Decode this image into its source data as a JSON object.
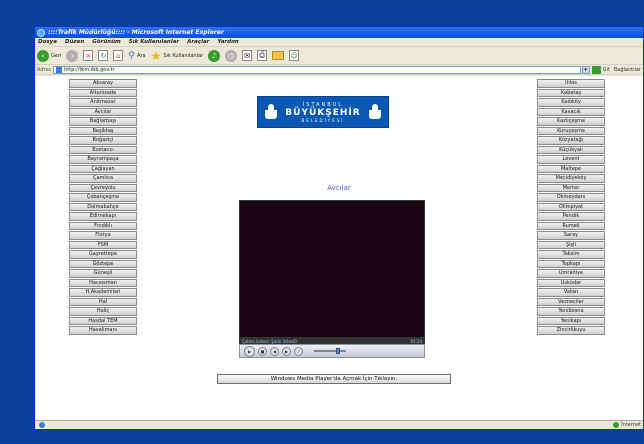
{
  "window": {
    "title": "::::Trafik Müdürlüğü:::: - Microsoft Internet Explorer"
  },
  "menu": [
    "Dosya",
    "Düzen",
    "Görünüm",
    "Sık Kullanılanlar",
    "Araçlar",
    "Yardım"
  ],
  "toolbar": {
    "back_label": "Geri",
    "search_label": "Ara",
    "favorites_label": "Sık Kullanılanlar"
  },
  "addressbar": {
    "label": "Adres",
    "url": "http://tkm.ibb.gov.tr",
    "go_label": "Git",
    "links_label": "Bağlantılar"
  },
  "logo": {
    "line1": "İSTANBUL",
    "line2": "BÜYÜKŞEHİR",
    "line3": "BELEDİYESİ"
  },
  "camera": {
    "title": "Avcılar",
    "status_text": "Çalma Listesi: Şarkı listesi0",
    "time": "01:24"
  },
  "open_button_label": "Windows Media Player'da Açmak İçin Tıklayın.",
  "left_nav": [
    "Aksaray",
    "Altunizade",
    "Anitmezar",
    "Avcılar",
    "Bağlarbaşı",
    "Beşiktaş",
    "Boğaziçi",
    "Bostancı",
    "Bayrampaşa",
    "Çağlayan",
    "Çamlıca",
    "Çevreyolu",
    "Çobançeşme",
    "Dolmabahçe",
    "Edirnekapı",
    "Fındıklı",
    "Florya",
    "FSM",
    "Gayrettepe",
    "Göztepe",
    "Güneşli",
    "Hacıosman",
    "H.Akademileri",
    "Hal",
    "Haliç",
    "Hasdal TEM",
    "Havalimanı"
  ],
  "right_nav": [
    "İhlas",
    "Kabataş",
    "Kadıköy",
    "Kavacık",
    "Kazlıçeşme",
    "Kuruçeşme",
    "Kozyatağı",
    "Küçükyalı",
    "Levent",
    "Maltepe",
    "Mecidiyeköy",
    "Merter",
    "Okmeydanı",
    "Olimpiyat",
    "Pendik",
    "Rumeli",
    "Saray",
    "Şişli",
    "Taksim",
    "Topkapı",
    "Ümraniye",
    "Üsküdar",
    "Vatan",
    "Vezneciler",
    "Yenibosna",
    "Yenikapı",
    "Zincirlikuyu"
  ],
  "statusbar": {
    "zone": "İnternet"
  }
}
